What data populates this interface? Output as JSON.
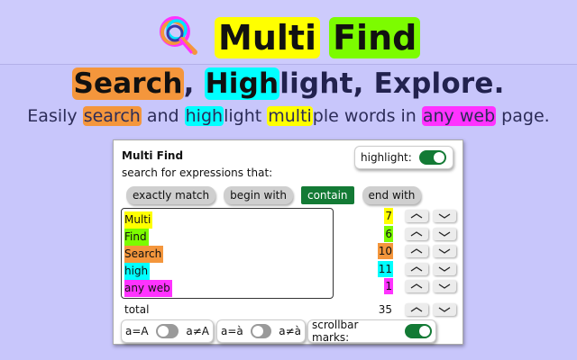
{
  "header": {
    "title_words": [
      {
        "text": "Multi",
        "color": "#ffff00"
      },
      {
        "text": "Find",
        "color": "#7cfc00"
      }
    ],
    "tagline": [
      {
        "text": "Search",
        "hl": "#f4963c"
      },
      {
        "text": ", ",
        "hl": null
      },
      {
        "text": "High",
        "hl": "#00ffff"
      },
      {
        "text": "light, Explore.",
        "hl": null
      }
    ],
    "subtitle": [
      {
        "text": "Easily ",
        "hl": null
      },
      {
        "text": "search",
        "hl": "#f4963c"
      },
      {
        "text": " and ",
        "hl": null
      },
      {
        "text": "high",
        "hl": "#00ffff"
      },
      {
        "text": "light ",
        "hl": null
      },
      {
        "text": "multi",
        "hl": "#ffff00"
      },
      {
        "text": "ple words in ",
        "hl": null
      },
      {
        "text": "any web",
        "hl": "#ff33ff"
      },
      {
        "text": " page.",
        "hl": null
      }
    ]
  },
  "popup": {
    "title": "Multi Find",
    "subtitle": "search for expressions that:",
    "highlight_label": "highlight:",
    "highlight_on": true,
    "modes": [
      {
        "label": "exactly match",
        "active": false
      },
      {
        "label": "begin with",
        "active": false
      },
      {
        "label": "contain",
        "active": true
      },
      {
        "label": "end with",
        "active": false
      }
    ],
    "terms": [
      {
        "text": "Multi",
        "color": "#ffff00",
        "count": "7"
      },
      {
        "text": "Find",
        "color": "#7cfc00",
        "count": "6"
      },
      {
        "text": "Search",
        "color": "#f4963c",
        "count": "10"
      },
      {
        "text": "high",
        "color": "#00ffff",
        "count": "11"
      },
      {
        "text": "any web",
        "color": "#ff33ff",
        "count": "1"
      }
    ],
    "total_label": "total",
    "total_count": "35",
    "options": {
      "case_left": "a=A",
      "case_right": "a≠A",
      "accent_left": "a=à",
      "accent_right": "a≠à",
      "scrollbar_label": "scrollbar marks:",
      "scrollbar_on": true
    },
    "icons": {
      "up": "chevron-up-icon",
      "down": "chevron-down-icon",
      "logo": "magnifier-logo-icon"
    },
    "accent_color": "#137a35"
  }
}
